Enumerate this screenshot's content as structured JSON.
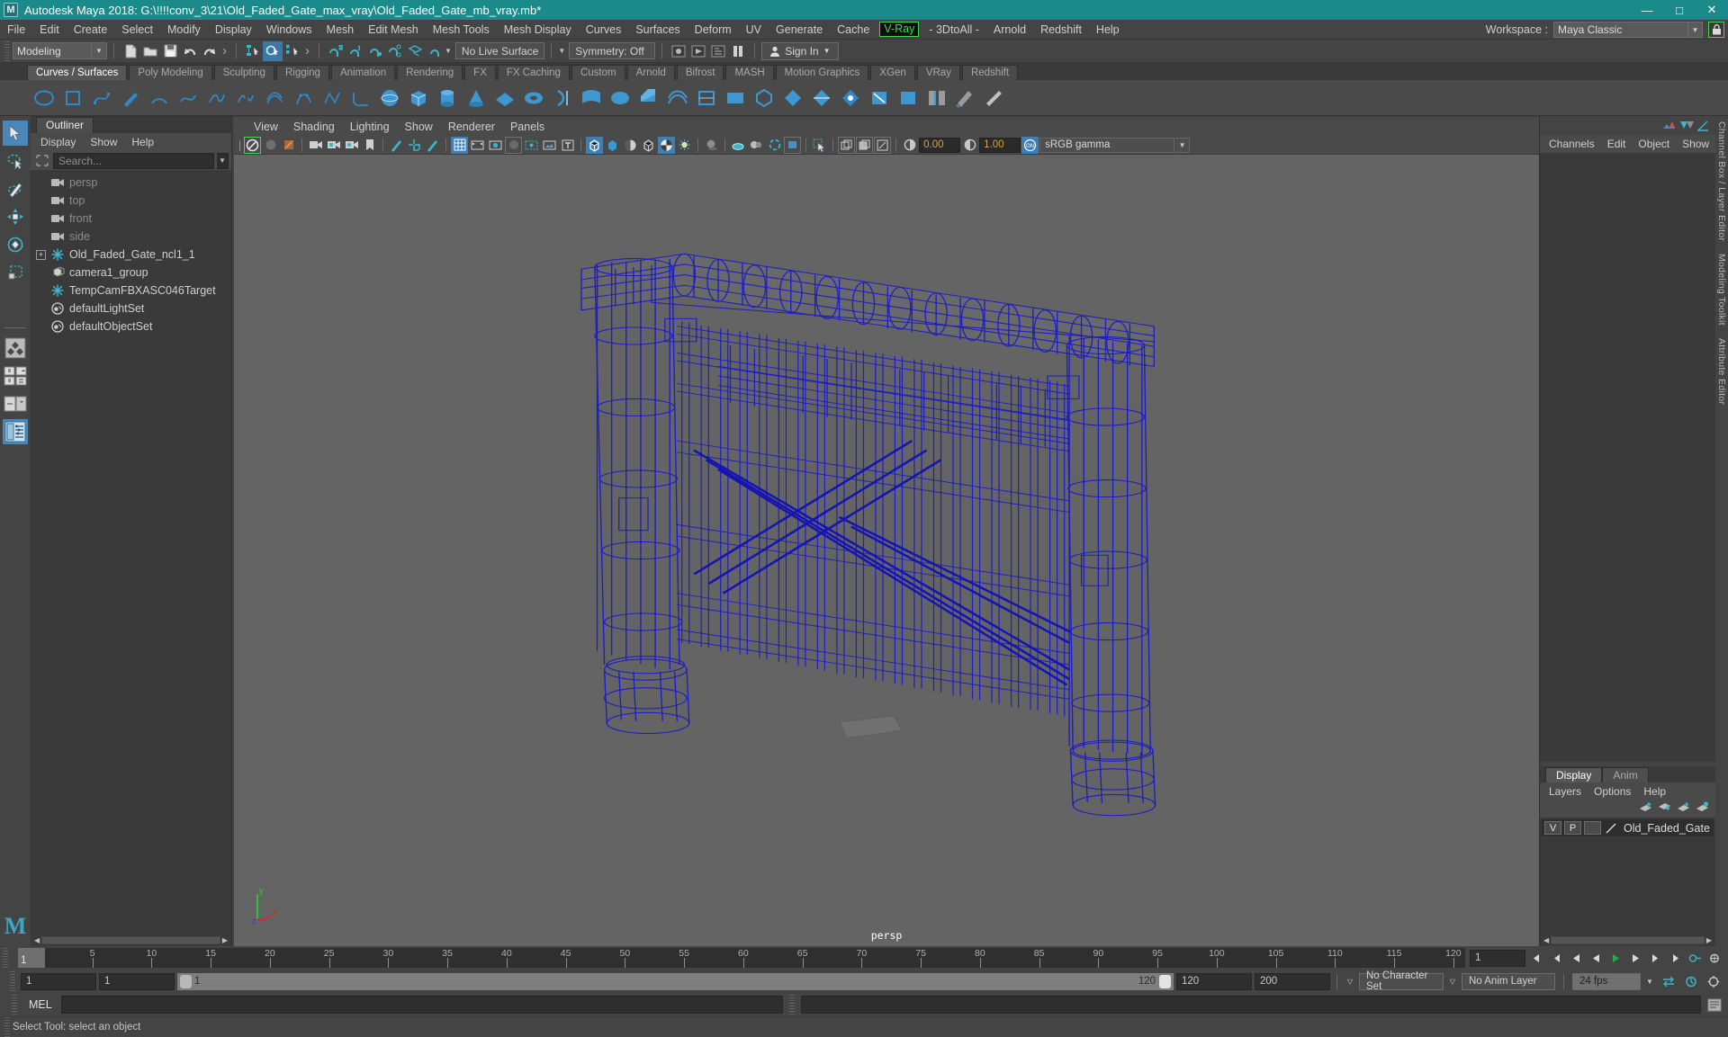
{
  "titlebar": {
    "app_title": "Autodesk Maya 2018: G:\\!!!!conv_3\\21\\Old_Faded_Gate_max_vray\\Old_Faded_Gate_mb_vray.mb*",
    "logo": "M",
    "minimize": "—",
    "maximize": "□",
    "close": "✕"
  },
  "menubar": {
    "items": [
      {
        "label": "File"
      },
      {
        "label": "Edit"
      },
      {
        "label": "Create"
      },
      {
        "label": "Select"
      },
      {
        "label": "Modify"
      },
      {
        "label": "Display"
      },
      {
        "label": "Windows"
      },
      {
        "label": "Mesh"
      },
      {
        "label": "Edit Mesh"
      },
      {
        "label": "Mesh Tools"
      },
      {
        "label": "Mesh Display"
      },
      {
        "label": "Curves"
      },
      {
        "label": "Surfaces"
      },
      {
        "label": "Deform"
      },
      {
        "label": "UV"
      },
      {
        "label": "Generate"
      },
      {
        "label": "Cache"
      }
    ],
    "vray": "V-Ray",
    "after_vray": [
      {
        "label": "- 3DtoAll -"
      },
      {
        "label": "Arnold"
      },
      {
        "label": "Redshift"
      },
      {
        "label": "Help"
      }
    ],
    "workspace_label": "Workspace :",
    "workspace_value": "Maya Classic",
    "lock_icon": "lock-icon"
  },
  "statusbar": {
    "mode": "Modeling",
    "live_surface": "No Live Surface",
    "symmetry": "Symmetry: Off",
    "signin": "Sign In"
  },
  "shelf": {
    "tabs": [
      {
        "label": "Curves / Surfaces",
        "active": true
      },
      {
        "label": "Poly Modeling",
        "active": false
      },
      {
        "label": "Sculpting",
        "active": false
      },
      {
        "label": "Rigging",
        "active": false
      },
      {
        "label": "Animation",
        "active": false
      },
      {
        "label": "Rendering",
        "active": false
      },
      {
        "label": "FX",
        "active": false
      },
      {
        "label": "FX Caching",
        "active": false
      },
      {
        "label": "Custom",
        "active": false
      },
      {
        "label": "Arnold",
        "active": false
      },
      {
        "label": "Bifrost",
        "active": false
      },
      {
        "label": "MASH",
        "active": false
      },
      {
        "label": "Motion Graphics",
        "active": false
      },
      {
        "label": "XGen",
        "active": false
      },
      {
        "label": "VRay",
        "active": false
      },
      {
        "label": "Redshift",
        "active": false
      }
    ]
  },
  "toolbox": {
    "items": [
      {
        "name": "select-tool",
        "active": true
      },
      {
        "name": "lasso-select-tool",
        "active": false
      },
      {
        "name": "paint-select-tool",
        "active": false
      },
      {
        "name": "move-tool",
        "active": false
      },
      {
        "name": "rotate-tool",
        "active": false
      },
      {
        "name": "scale-tool",
        "active": false
      },
      {
        "name": "last-tool",
        "active": false
      },
      {
        "name": "four-view-layout",
        "active": false
      },
      {
        "name": "persp-outliner-layout",
        "active": false
      },
      {
        "name": "persp-graph-layout",
        "active": false
      },
      {
        "name": "outliner-persp-layout",
        "active": true
      }
    ],
    "logo": "M"
  },
  "outliner": {
    "tab": "Outliner",
    "menus": [
      {
        "label": "Display"
      },
      {
        "label": "Show"
      },
      {
        "label": "Help"
      }
    ],
    "search_placeholder": "Search...",
    "items": [
      {
        "label": "persp",
        "icon": "camera-icon",
        "dim": true,
        "expand": false
      },
      {
        "label": "top",
        "icon": "camera-icon",
        "dim": true,
        "expand": false
      },
      {
        "label": "front",
        "icon": "camera-icon",
        "dim": true,
        "expand": false
      },
      {
        "label": "side",
        "icon": "camera-icon",
        "dim": true,
        "expand": false
      },
      {
        "label": "Old_Faded_Gate_ncl1_1",
        "icon": "transform-icon",
        "dim": false,
        "expand": true
      },
      {
        "label": "camera1_group",
        "icon": "group-icon",
        "dim": false,
        "expand": false
      },
      {
        "label": "TempCamFBXASC046Target",
        "icon": "transform-icon",
        "dim": false,
        "expand": false
      },
      {
        "label": "defaultLightSet",
        "icon": "set-icon",
        "dim": false,
        "expand": false
      },
      {
        "label": "defaultObjectSet",
        "icon": "set-icon",
        "dim": false,
        "expand": false
      }
    ]
  },
  "viewport": {
    "menus": [
      {
        "label": "View"
      },
      {
        "label": "Shading"
      },
      {
        "label": "Lighting"
      },
      {
        "label": "Show"
      },
      {
        "label": "Renderer"
      },
      {
        "label": "Panels"
      }
    ],
    "exposure": "0.00",
    "gamma": "1.00",
    "color_space": "sRGB gamma",
    "camera_label": "persp",
    "axis": {
      "x": "x",
      "y": "y",
      "z": "z"
    },
    "background_color": "#646464",
    "wireframe_color": "#1c1cc8",
    "model_name": "Old_Faded_Gate"
  },
  "channelbox": {
    "menus": [
      {
        "label": "Channels"
      },
      {
        "label": "Edit"
      },
      {
        "label": "Object"
      },
      {
        "label": "Show"
      }
    ]
  },
  "layers": {
    "tabs": [
      {
        "label": "Display",
        "active": true
      },
      {
        "label": "Anim",
        "active": false
      }
    ],
    "menus": [
      {
        "label": "Layers"
      },
      {
        "label": "Options"
      },
      {
        "label": "Help"
      }
    ],
    "rows": [
      {
        "v": "V",
        "p": "P",
        "color": "",
        "name": "Old_Faded_Gate"
      }
    ]
  },
  "vertical_tabs": [
    {
      "label": "Channel Box / Layer Editor"
    },
    {
      "label": "Modeling Toolkit"
    },
    {
      "label": "Attribute Editor"
    }
  ],
  "timeslider": {
    "current_frame": "1",
    "ticks": [
      5,
      10,
      15,
      20,
      25,
      30,
      35,
      40,
      45,
      50,
      55,
      60,
      65,
      70,
      75,
      80,
      85,
      90,
      95,
      100,
      105,
      110,
      115,
      120
    ],
    "range_start": 1,
    "range_end": 121,
    "playback_field": "1"
  },
  "rangeslider": {
    "start": "1",
    "end": "1",
    "bar_start": "1",
    "bar_end": "120",
    "anim_end": "120",
    "playback_end": "200",
    "character_set": "No Character Set",
    "anim_layer": "No Anim Layer",
    "fps": "24 fps"
  },
  "commandline": {
    "label": "MEL",
    "input_value": "",
    "output_value": ""
  },
  "helpline": {
    "text": "Select Tool: select an object"
  }
}
